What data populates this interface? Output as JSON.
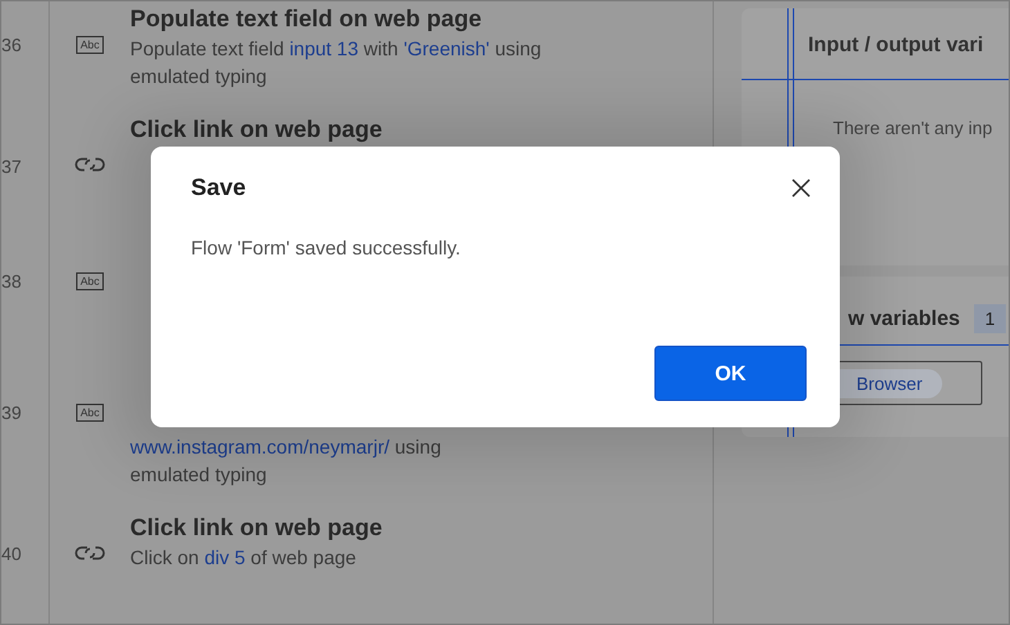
{
  "steps": [
    {
      "number": "36",
      "kind": "text-field",
      "icon_label": "Abc",
      "title": "Populate text field on web page",
      "subtitle": [
        {
          "text": "Populate text field ",
          "token": false
        },
        {
          "text": "input 13",
          "token": true
        },
        {
          "text": " with ",
          "token": false
        },
        {
          "text": "'Greenish'",
          "token": true
        },
        {
          "text": " using emulated typing",
          "token": false
        }
      ]
    },
    {
      "number": "37",
      "kind": "link",
      "title": "Click link on web page"
    },
    {
      "number": "38",
      "kind": "text-field",
      "icon_label": "Abc"
    },
    {
      "number": "39",
      "kind": "text-field",
      "icon_label": "Abc",
      "subtitle": [
        {
          "text": "www.instagram.com/neymarjr/",
          "token": true
        },
        {
          "text": "  using emulated typing",
          "token": false
        }
      ]
    },
    {
      "number": "40",
      "kind": "link",
      "title": "Click link on web page",
      "subtitle": [
        {
          "text": "Click on ",
          "token": false
        },
        {
          "text": "div 5",
          "token": true
        },
        {
          "text": " of web page",
          "token": false
        }
      ]
    }
  ],
  "io_panel": {
    "title": "Input / output vari",
    "empty_message": "There aren't any inp"
  },
  "flow_variables": {
    "title": "w variables",
    "count": "1",
    "chips": [
      "Browser"
    ]
  },
  "dialog": {
    "title": "Save",
    "message": "Flow 'Form' saved successfully.",
    "buttons": [
      "OK"
    ]
  }
}
